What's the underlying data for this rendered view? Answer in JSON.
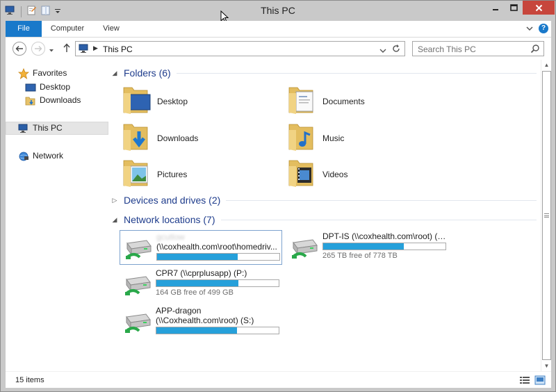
{
  "window": {
    "title": "This PC"
  },
  "ribbon": {
    "tabs": [
      "File",
      "Computer",
      "View"
    ]
  },
  "address": {
    "location": "This PC",
    "search_placeholder": "Search This PC"
  },
  "nav": {
    "favorites": "Favorites",
    "favorites_items": [
      "Desktop",
      "Downloads"
    ],
    "this_pc": "This PC",
    "network": "Network"
  },
  "groups": {
    "folders": "Folders (6)",
    "devices": "Devices and drives (2)",
    "network": "Network locations (7)"
  },
  "folders": [
    {
      "name": "Desktop",
      "icon": "folder-desktop-icon"
    },
    {
      "name": "Documents",
      "icon": "folder-documents-icon"
    },
    {
      "name": "Downloads",
      "icon": "folder-downloads-icon"
    },
    {
      "name": "Music",
      "icon": "folder-music-icon"
    },
    {
      "name": "Pictures",
      "icon": "folder-pictures-icon"
    },
    {
      "name": "Videos",
      "icon": "folder-videos-icon"
    }
  ],
  "network_drives": [
    {
      "name_blurred": "gcutlow",
      "name": "(\\\\coxhealth.com\\root\\homedriv...",
      "free": "",
      "usage_fraction": 0.66
    },
    {
      "name": "DPT-IS (\\\\coxhealth.com\\root) (H:)",
      "free": "265 TB free of 778 TB",
      "usage_fraction": 0.66
    },
    {
      "name": "CPR7 (\\\\cprplusapp) (P:)",
      "free": "164 GB free of 499 GB",
      "usage_fraction": 0.67
    },
    {
      "name": "APP-dragon",
      "name2": "(\\\\Coxhealth.com\\root) (S:)",
      "free": "",
      "usage_fraction": 0.66
    }
  ],
  "status": {
    "items": "15 items"
  },
  "colors": {
    "accent": "#1979ca",
    "bar_fill": "#26a0da",
    "group_title": "#1e3c8c"
  }
}
